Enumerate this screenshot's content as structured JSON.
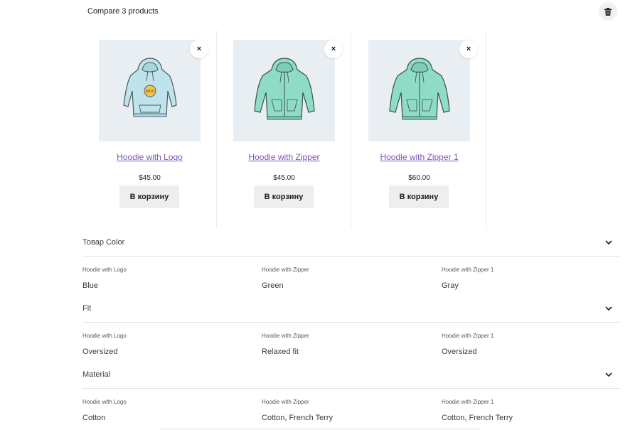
{
  "header": {
    "title": "Compare 3 products",
    "trash_icon": "trash-icon"
  },
  "colors": {
    "link": "#7f54b3",
    "image_bg": "#e9eef3",
    "button_bg": "#eeeeee",
    "hoodie_blue": "#bfe3ea",
    "hoodie_green": "#8fdcc4"
  },
  "products": [
    {
      "name": "Hoodie with Logo",
      "price": "$45.00",
      "cart_label": "В корзину",
      "remove_label": "×",
      "image": "hoodie-with-logo-image"
    },
    {
      "name": "Hoodie with Zipper",
      "price": "$45.00",
      "cart_label": "В корзину",
      "remove_label": "×",
      "image": "hoodie-with-zipper-image"
    },
    {
      "name": "Hoodie with Zipper 1",
      "price": "$60.00",
      "cart_label": "В корзину",
      "remove_label": "×",
      "image": "hoodie-with-zipper-image"
    }
  ],
  "attributes": [
    {
      "title": "Товар Color",
      "cells": [
        {
          "label": "Hoodie with Logo",
          "value": "Blue"
        },
        {
          "label": "Hoodie with Zipper",
          "value": "Green"
        },
        {
          "label": "Hoodie with Zipper 1",
          "value": "Gray"
        }
      ]
    },
    {
      "title": "Fit",
      "cells": [
        {
          "label": "Hoodie with Logo",
          "value": "Oversized"
        },
        {
          "label": "Hoodie with Zipper",
          "value": "Relaxed fit"
        },
        {
          "label": "Hoodie with Zipper 1",
          "value": "Oversized"
        }
      ]
    },
    {
      "title": "Material",
      "cells": [
        {
          "label": "Hoodie with Logo",
          "value": "Cotton"
        },
        {
          "label": "Hoodie with Zipper",
          "value": "Cotton, French Terry"
        },
        {
          "label": "Hoodie with Zipper 1",
          "value": "Cotton, French Terry"
        }
      ]
    }
  ]
}
